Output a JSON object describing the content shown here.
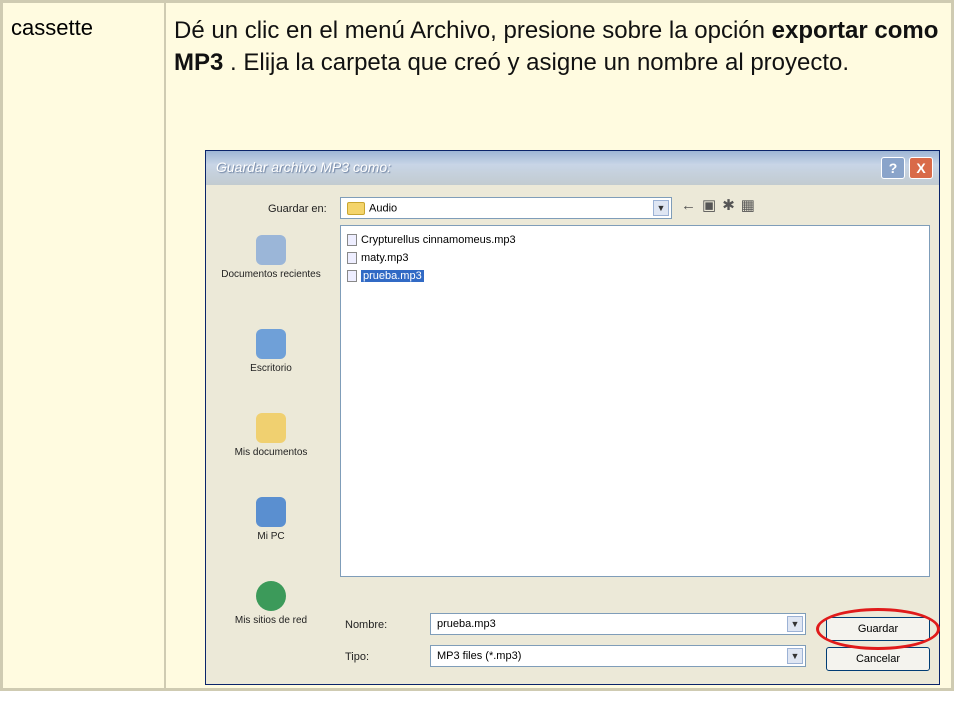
{
  "left_cell": {
    "text": "cassette"
  },
  "instruction": {
    "part1": "Dé un clic en el menú Archivo, presione sobre la opción",
    "bold": "exportar como MP3",
    "part2": " . Elija la carpeta que creó y asigne un nombre al proyecto."
  },
  "dialog": {
    "title": "Guardar archivo MP3 como:",
    "help_label": "?",
    "close_label": "X",
    "save_in_label": "Guardar en:",
    "save_in_value": "Audio",
    "places": [
      "Documentos recientes",
      "Escritorio",
      "Mis documentos",
      "Mi PC",
      "Mis sitios de red"
    ],
    "files": [
      {
        "name": "Crypturellus cinnamomeus.mp3",
        "selected": false
      },
      {
        "name": "maty.mp3",
        "selected": false
      },
      {
        "name": "prueba.mp3",
        "selected": true
      }
    ],
    "filename_label": "Nombre:",
    "filename_value": "prueba.mp3",
    "type_label": "Tipo:",
    "type_value": "MP3 files (*.mp3)",
    "save_button": "Guardar",
    "cancel_button": "Cancelar"
  },
  "colors": {
    "frame": "#cfcbb2",
    "cell_bg": "#fffbe0",
    "highlight_ring": "#e01b1b",
    "selection": "#316ac5"
  }
}
